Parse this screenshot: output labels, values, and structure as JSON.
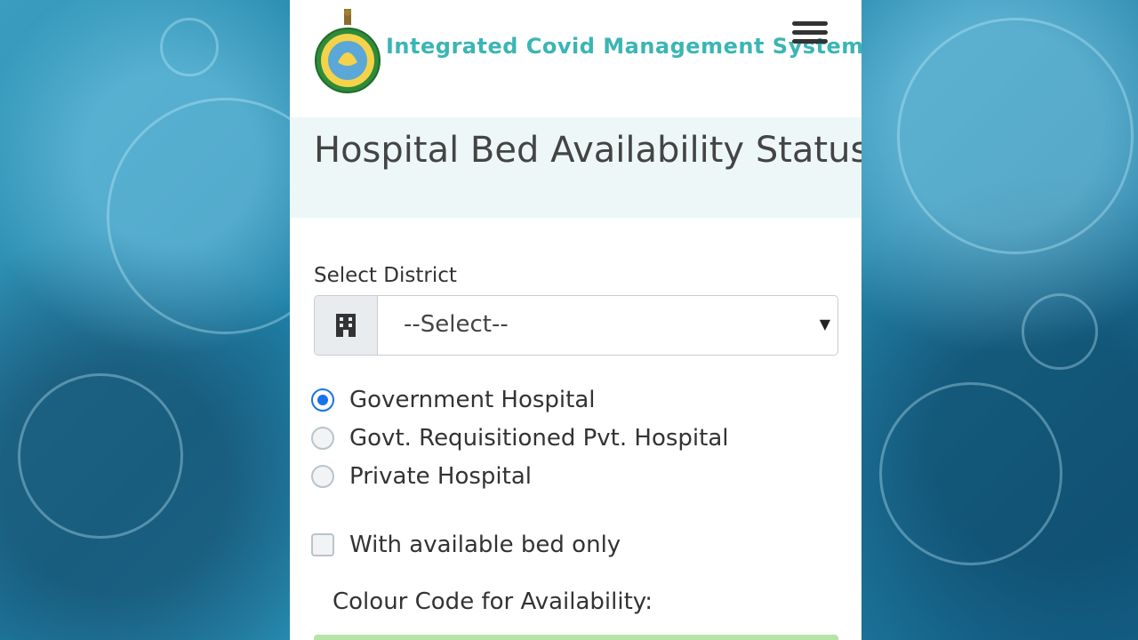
{
  "header": {
    "brand_title": "Integrated Covid Management System",
    "brand_color": "#3bb5b5",
    "menu_icon": "hamburger-menu-icon"
  },
  "hero": {
    "title": "Hospital Bed Availability Status"
  },
  "form": {
    "district_label": "Select District",
    "district_icon": "building-icon",
    "district_selected": "--Select--",
    "hospital_types": [
      {
        "label": "Government Hospital",
        "checked": true
      },
      {
        "label": "Govt. Requisitioned Pvt. Hospital",
        "checked": false
      },
      {
        "label": "Private Hospital",
        "checked": false
      }
    ],
    "available_only_label": "With available bed only",
    "available_only_checked": false,
    "colour_code_label": "Colour Code for Availability:"
  },
  "colors": {
    "accent": "#1a73e8",
    "hero_bg": "#eef7f8",
    "legend_green": "#b7e4a6"
  }
}
